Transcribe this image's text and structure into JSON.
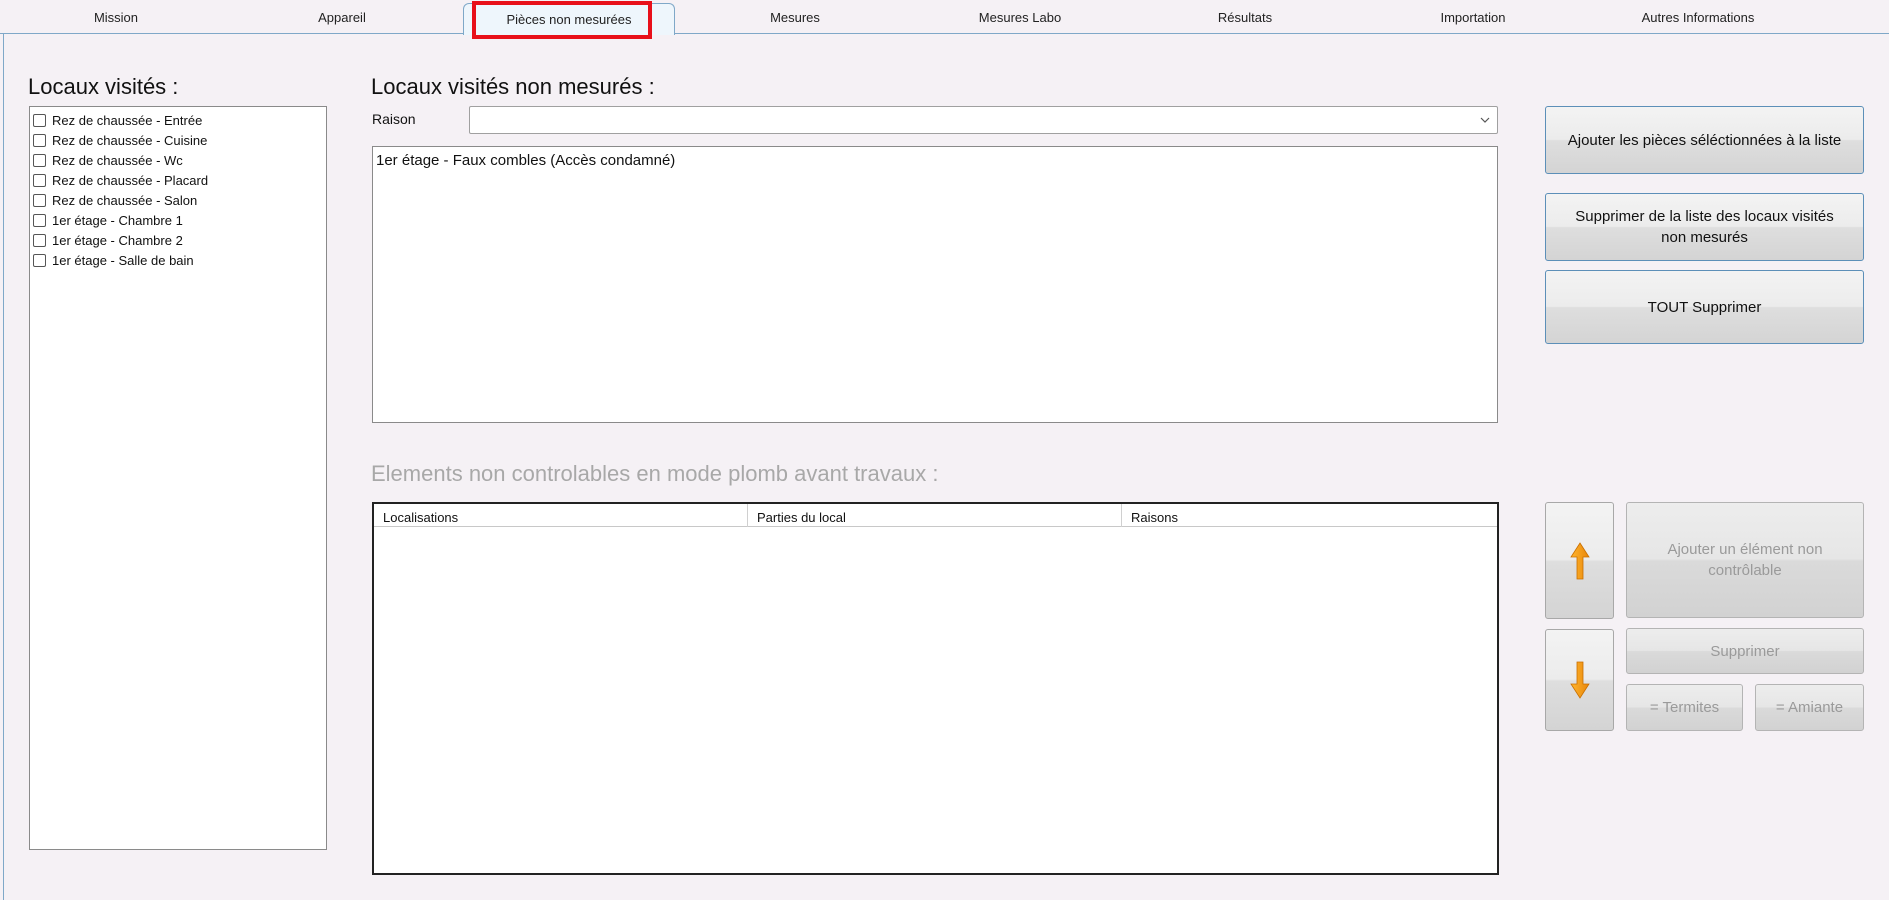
{
  "tabs": [
    {
      "label": "Mission",
      "active": false
    },
    {
      "label": "Appareil",
      "active": false
    },
    {
      "label": "Pièces non mesurées",
      "active": true
    },
    {
      "label": "Mesures",
      "active": false
    },
    {
      "label": "Mesures Labo",
      "active": false
    },
    {
      "label": "Résultats",
      "active": false
    },
    {
      "label": "Importation",
      "active": false
    },
    {
      "label": "Autres Informations",
      "active": false
    }
  ],
  "visited": {
    "title": "Locaux visités :",
    "items": [
      {
        "label": "Rez de chaussée - Entrée",
        "checked": false
      },
      {
        "label": "Rez de chaussée - Cuisine",
        "checked": false
      },
      {
        "label": "Rez de chaussée - Wc",
        "checked": false
      },
      {
        "label": "Rez de chaussée - Placard",
        "checked": false
      },
      {
        "label": "Rez de chaussée - Salon",
        "checked": false
      },
      {
        "label": "1er étage - Chambre 1",
        "checked": false
      },
      {
        "label": "1er étage - Chambre 2",
        "checked": false
      },
      {
        "label": "1er étage - Salle de bain",
        "checked": false
      }
    ]
  },
  "non_measured": {
    "title": "Locaux visités non mesurés :",
    "reason_label": "Raison",
    "reason_value": "",
    "items": [
      "1er étage - Faux combles (Accès condamné)"
    ]
  },
  "buttons": {
    "add_selected": "Ajouter les pièces séléctionnées à la liste",
    "remove_from_list": "Supprimer de la liste des locaux visités non mesurés",
    "delete_all": "TOUT Supprimer",
    "add_element": "Ajouter un élément non contrôlable",
    "delete": "Supprimer",
    "termites": "= Termites",
    "amiante": "= Amiante"
  },
  "elements": {
    "title": "Elements non controlables en mode plomb avant travaux :",
    "columns": [
      "Localisations",
      "Parties du local",
      "Raisons"
    ],
    "rows": []
  },
  "colors": {
    "active_tab_highlight": "#e8101a",
    "arrow_orange": "#f39c12",
    "accent_border": "#5c8fb8"
  },
  "icons": {
    "move_up": "arrow-up-icon",
    "move_down": "arrow-down-icon",
    "combo": "chevron-down-icon"
  }
}
